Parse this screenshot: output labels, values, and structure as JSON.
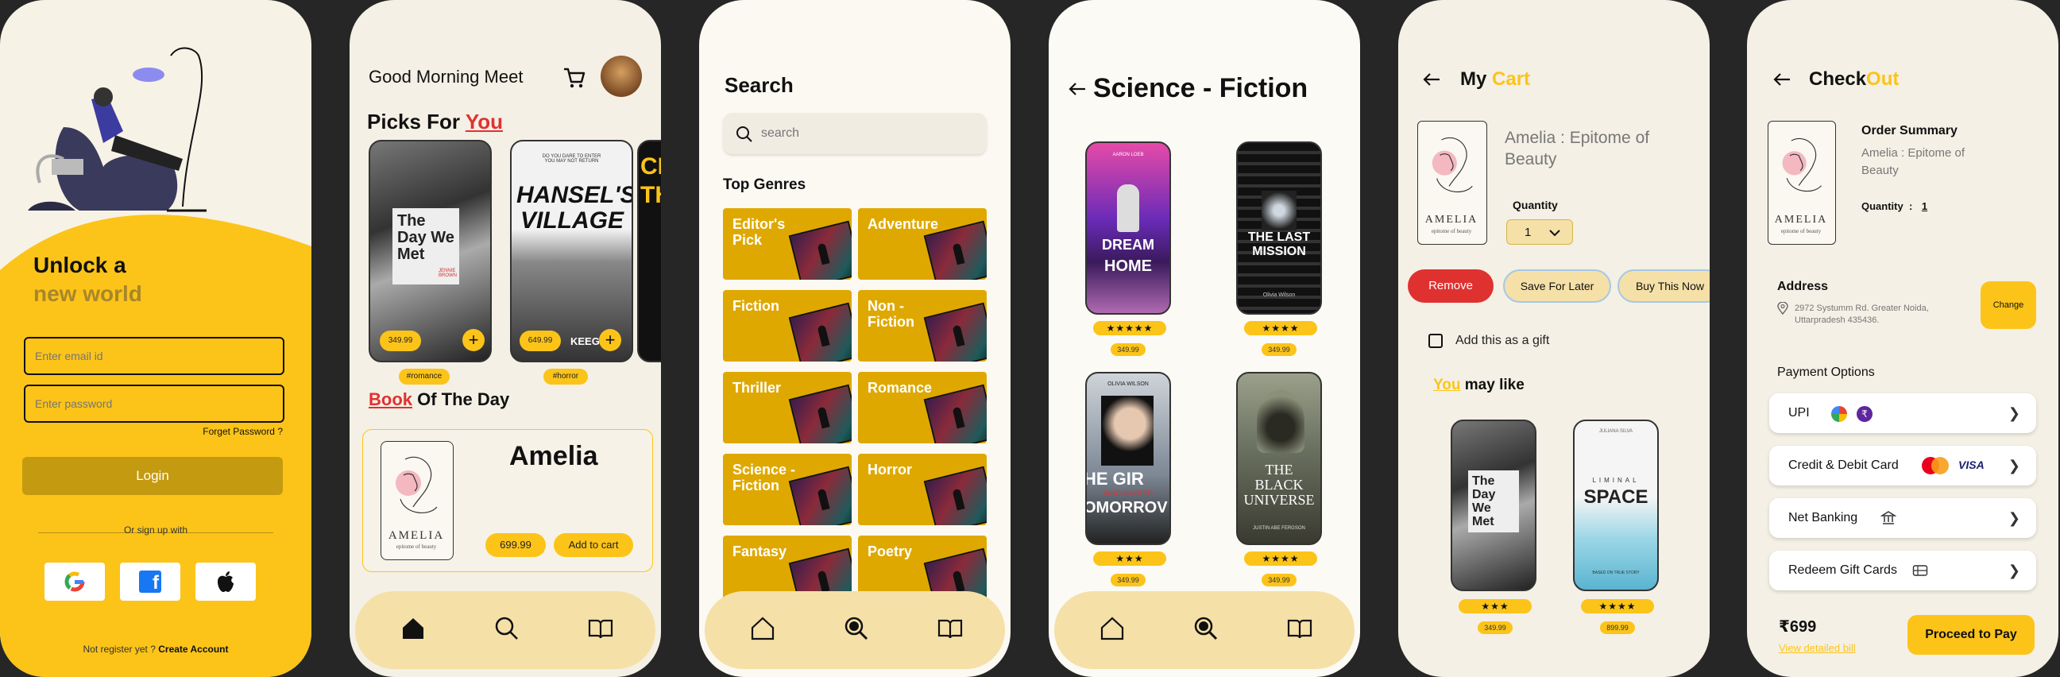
{
  "s1": {
    "title_a": "Unlock a",
    "title_b": "new world",
    "email_ph": "Enter email id",
    "password_ph": "Enter password",
    "forget": "Forget Password ?",
    "login": "Login",
    "or_signup": "Or sign up with",
    "no_account": "Not register yet ? ",
    "create": "Create Account"
  },
  "s2": {
    "greeting": "Good Morning Meet",
    "picks_a": "Picks For ",
    "picks_b": "You",
    "books": [
      {
        "title": "The Day We Met",
        "price": "349.99",
        "tag": "#romance"
      },
      {
        "title": "HANSEL'S VILLAGE",
        "price": "649.99",
        "tag": "#horror"
      },
      {
        "title": "CI TH",
        "price": ""
      }
    ],
    "botd_a": "Book",
    "botd_b": " Of The Day",
    "botd_title": "Amelia",
    "botd_price": "699.99",
    "add_cart": "Add to cart",
    "cover_amelia": "AMELIA",
    "cover_amelia_sub": "epitome of beauty",
    "hansel_top": "DO YOU DARE TO ENTER\nYOU MAY NOT RETURN",
    "hansel_author": "KEEG",
    "daywemet_author": "JENNIE\nBROWN"
  },
  "s3": {
    "title": "Search",
    "search_ph": "search",
    "top_genres": "Top Genres",
    "genres": [
      "Editor's Pick",
      "Adventure",
      "Fiction",
      "Non - Fiction",
      "Thriller",
      "Romance",
      "Science - Fiction",
      "Horror",
      "Fantasy",
      "Poetry"
    ]
  },
  "s4": {
    "title": "Science - Fiction",
    "books": [
      {
        "author": "AARON LOEB",
        "t1": "DREAM",
        "t2": "HOME",
        "stars": "★★★★★",
        "price": "349.99"
      },
      {
        "t1": "THE LAST MISSION",
        "author": "Olivia Wilson",
        "stars": "★★★★",
        "price": "349.99"
      },
      {
        "author": "OLIVIA WILSON",
        "t1": "HE GIR",
        "t2": "OMORROV",
        "sub": "WHO HACKED",
        "stars": "★★★",
        "price": "349.99"
      },
      {
        "t1": "THE BLACK UNIVERSE",
        "author": "JUSTIN ABE FERGSON",
        "stars": "★★★★",
        "price": "349.99"
      }
    ]
  },
  "s5": {
    "title_a": "My ",
    "title_b": "Cart",
    "book": "Amelia : Epitome of Beauty",
    "qty_label": "Quantity",
    "qty": "1",
    "remove": "Remove",
    "save_later": "Save For Later",
    "buy_now": "Buy This Now",
    "gift": "Add this as a gift",
    "may_a": "You",
    "may_b": " may like",
    "recs": [
      {
        "stars": "★★★",
        "price": "349.99"
      },
      {
        "stars": "★★★★",
        "price": "899.99",
        "author": "JULIANA SILVA",
        "t1": "LIMINAL",
        "t2": "SPACE",
        "sub": "BASED ON TRUE STORY"
      }
    ]
  },
  "s6": {
    "title_a": "Check",
    "title_b": "Out",
    "summary": "Order Summary",
    "book": "Amelia : Epitome of Beauty",
    "qty_label": "Quantity  :",
    "qty": "1",
    "address_label": "Address",
    "address": "2972 Systumm Rd. Greater Noida, Uttarpradesh 435436.",
    "change": "Change",
    "pay_options": "Payment Options",
    "options": [
      "UPI",
      "Credit & Debit Card",
      "Net Banking",
      "Redeem Gift Cards"
    ],
    "visa": "VISA",
    "total": "₹699",
    "view_bill": "View detailed bill",
    "proceed": "Proceed to Pay"
  },
  "colors": {
    "accent": "#fcc419",
    "red": "#e03131",
    "dark": "#111111",
    "cream": "#f4f0e5",
    "nav": "#f5e0a8"
  },
  "icons": [
    "home-icon",
    "search-icon",
    "book-icon",
    "cart-icon",
    "back-arrow-icon",
    "google-icon",
    "facebook-icon",
    "apple-icon",
    "chevron-right-icon",
    "location-icon",
    "bank-icon",
    "gift-card-icon"
  ]
}
